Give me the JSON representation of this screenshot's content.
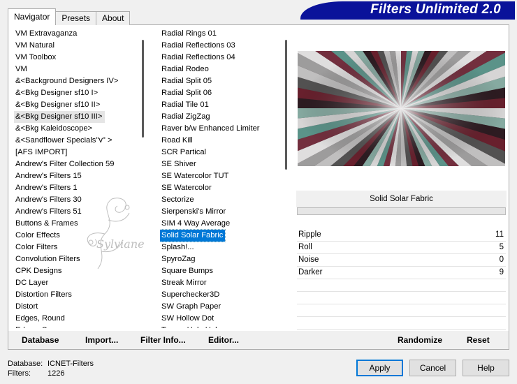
{
  "tabs": [
    {
      "label": "Navigator",
      "active": true
    },
    {
      "label": "Presets",
      "active": false
    },
    {
      "label": "About",
      "active": false
    }
  ],
  "banner": {
    "title": "Filters Unlimited 2.0"
  },
  "categories": [
    "VM Extravaganza",
    "VM Natural",
    "VM Toolbox",
    "VM",
    "&<Background Designers IV>",
    "&<Bkg Designer sf10 I>",
    "&<Bkg Designer sf10 II>",
    "&<Bkg Designer sf10 III>",
    "&<Bkg Kaleidoscope>",
    "&<Sandflower Specials\"v\" >",
    "[AFS IMPORT]",
    "Andrew's Filter Collection 59",
    "Andrew's Filters 15",
    "Andrew's Filters 1",
    "Andrew's Filters 30",
    "Andrew's Filters 51",
    "Buttons & Frames",
    "Color Effects",
    "Color Filters",
    "Convolution Filters",
    "CPK Designs",
    "DC Layer",
    "Distortion Filters",
    "Distort",
    "Edges, Round",
    "Edges, Square"
  ],
  "categories_hover": "&<Bkg Designer sf10 III>",
  "filters": [
    "Radial  Rings 01",
    "Radial Reflections 03",
    "Radial Reflections 04",
    "Radial Rodeo",
    "Radial Split 05",
    "Radial Split 06",
    "Radial Tile 01",
    "Radial ZigZag",
    "Raver b/w Enhanced Limiter",
    "Road Kill",
    "SCR  Partical",
    "SE Shiver",
    "SE Watercolor TUT",
    "SE Watercolor",
    "Sectorize",
    "Sierpenski's Mirror",
    "SIM 4 Way Average",
    "Solid Solar Fabric",
    "Splash!...",
    "SpyroZag",
    "Square Bumps",
    "Streak Mirror",
    "Superchecker3D",
    "SW Graph Paper",
    "SW Hollow Dot",
    "Tensor Hole Hole"
  ],
  "filters_selected": "Solid Solar Fabric",
  "selected_filter_name": "Solid Solar Fabric",
  "params": [
    {
      "name": "Ripple",
      "value": "11"
    },
    {
      "name": "Roll",
      "value": "5"
    },
    {
      "name": "Noise",
      "value": "0"
    },
    {
      "name": "Darker",
      "value": "9"
    },
    {
      "name": "",
      "value": ""
    },
    {
      "name": "",
      "value": ""
    },
    {
      "name": "",
      "value": ""
    },
    {
      "name": "",
      "value": ""
    }
  ],
  "actions": {
    "database": "Database",
    "import": "Import...",
    "filter_info": "Filter Info...",
    "editor": "Editor...",
    "randomize": "Randomize",
    "reset": "Reset"
  },
  "status": {
    "database_label": "Database:",
    "database_value": "ICNET-Filters",
    "filters_label": "Filters:",
    "filters_value": "1226"
  },
  "buttons": {
    "apply": "Apply",
    "cancel": "Cancel",
    "help": "Help"
  },
  "colors": {
    "banner": "#0a129a",
    "selection": "#0078d7"
  },
  "watermark_text": "Sylviane"
}
